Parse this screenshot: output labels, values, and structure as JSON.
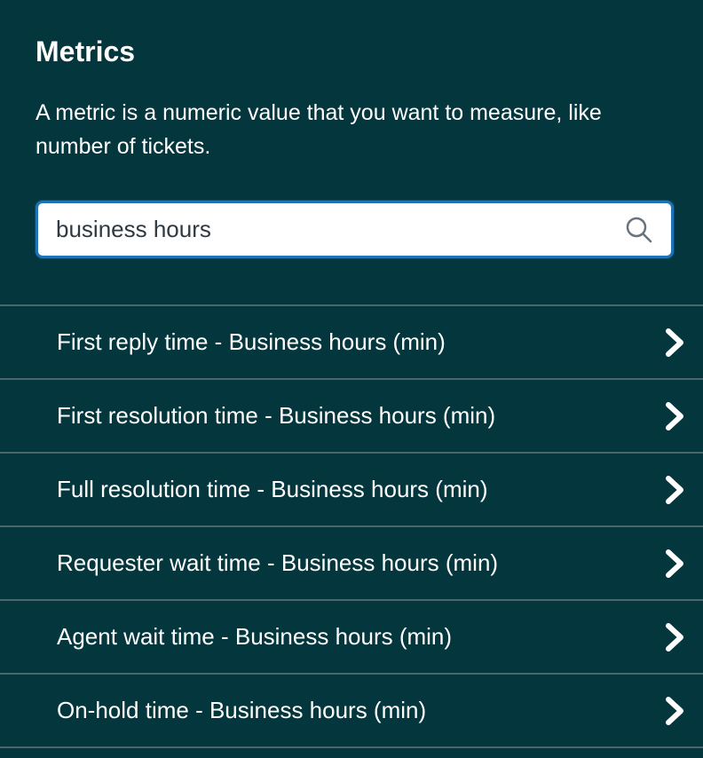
{
  "panel": {
    "title": "Metrics",
    "description": "A metric is a numeric value that you want to measure, like number of tickets."
  },
  "search": {
    "value": "business hours",
    "placeholder": "",
    "icon": "search-icon"
  },
  "metrics": [
    {
      "label": "First reply time - Business hours (min)",
      "icon": "chevron-right-icon"
    },
    {
      "label": "First resolution time - Business hours (min)",
      "icon": "chevron-right-icon"
    },
    {
      "label": "Full resolution time - Business hours (min)",
      "icon": "chevron-right-icon"
    },
    {
      "label": "Requester wait time - Business hours (min)",
      "icon": "chevron-right-icon"
    },
    {
      "label": "Agent wait time - Business hours (min)",
      "icon": "chevron-right-icon"
    },
    {
      "label": "On-hold time - Business hours (min)",
      "icon": "chevron-right-icon"
    }
  ],
  "colors": {
    "background": "#03363d",
    "divider": "#49666b",
    "focus_border": "#1f73b7",
    "text": "#ffffff",
    "input_text": "#2f3941"
  }
}
